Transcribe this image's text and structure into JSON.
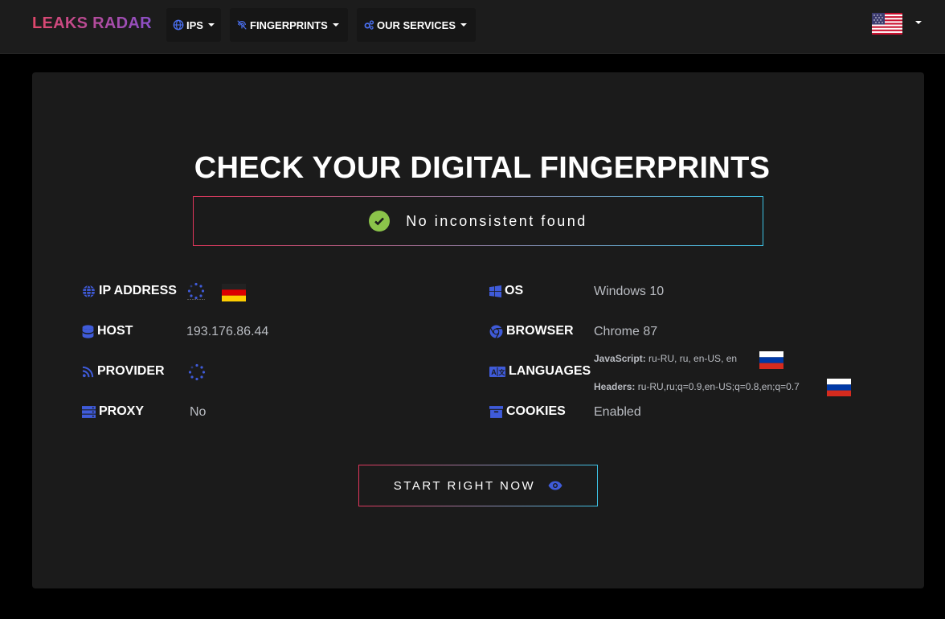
{
  "nav": {
    "brand": "LEAKS RADAR",
    "items": [
      {
        "label": "IPS",
        "icon": "globe-icon"
      },
      {
        "label": "FINGERPRINTS",
        "icon": "fingerprint-icon"
      },
      {
        "label": "OUR SERVICES",
        "icon": "cogs-icon"
      }
    ],
    "language_flag": "us-flag-icon"
  },
  "main": {
    "title": "CHECK YOUR DIGITAL FINGERPRINTS",
    "status": "No inconsistent found",
    "left": [
      {
        "label": "IP ADDRESS",
        "icon": "globe-icon",
        "value": "",
        "loading": true,
        "flag": "germany"
      },
      {
        "label": "HOST",
        "icon": "database-icon",
        "value": "193.176.86.44"
      },
      {
        "label": "PROVIDER",
        "icon": "rss-icon",
        "value": "",
        "loading": true
      },
      {
        "label": "PROXY",
        "icon": "server-icon",
        "value": "No"
      }
    ],
    "right": [
      {
        "label": "OS",
        "icon": "windows-icon",
        "value": "Windows 10"
      },
      {
        "label": "BROWSER",
        "icon": "chrome-icon",
        "value": "Chrome 87"
      },
      {
        "label": "LANGUAGES",
        "icon": "language-icon",
        "javascript_label": "JavaScript:",
        "javascript_value": "ru-RU, ru, en-US, en",
        "headers_label": "Headers:",
        "headers_value": "ru-RU,ru;q=0.9,en-US;q=0.8,en;q=0.7"
      },
      {
        "label": "COOKIES",
        "icon": "archive-icon",
        "value": "Enabled"
      }
    ],
    "cta": "START RIGHT NOW"
  },
  "colors": {
    "accent_blue": "#3f5bd9",
    "gradient_start": "#e0365b",
    "gradient_end": "#3dc3e6",
    "check_green": "#8bc34a"
  }
}
